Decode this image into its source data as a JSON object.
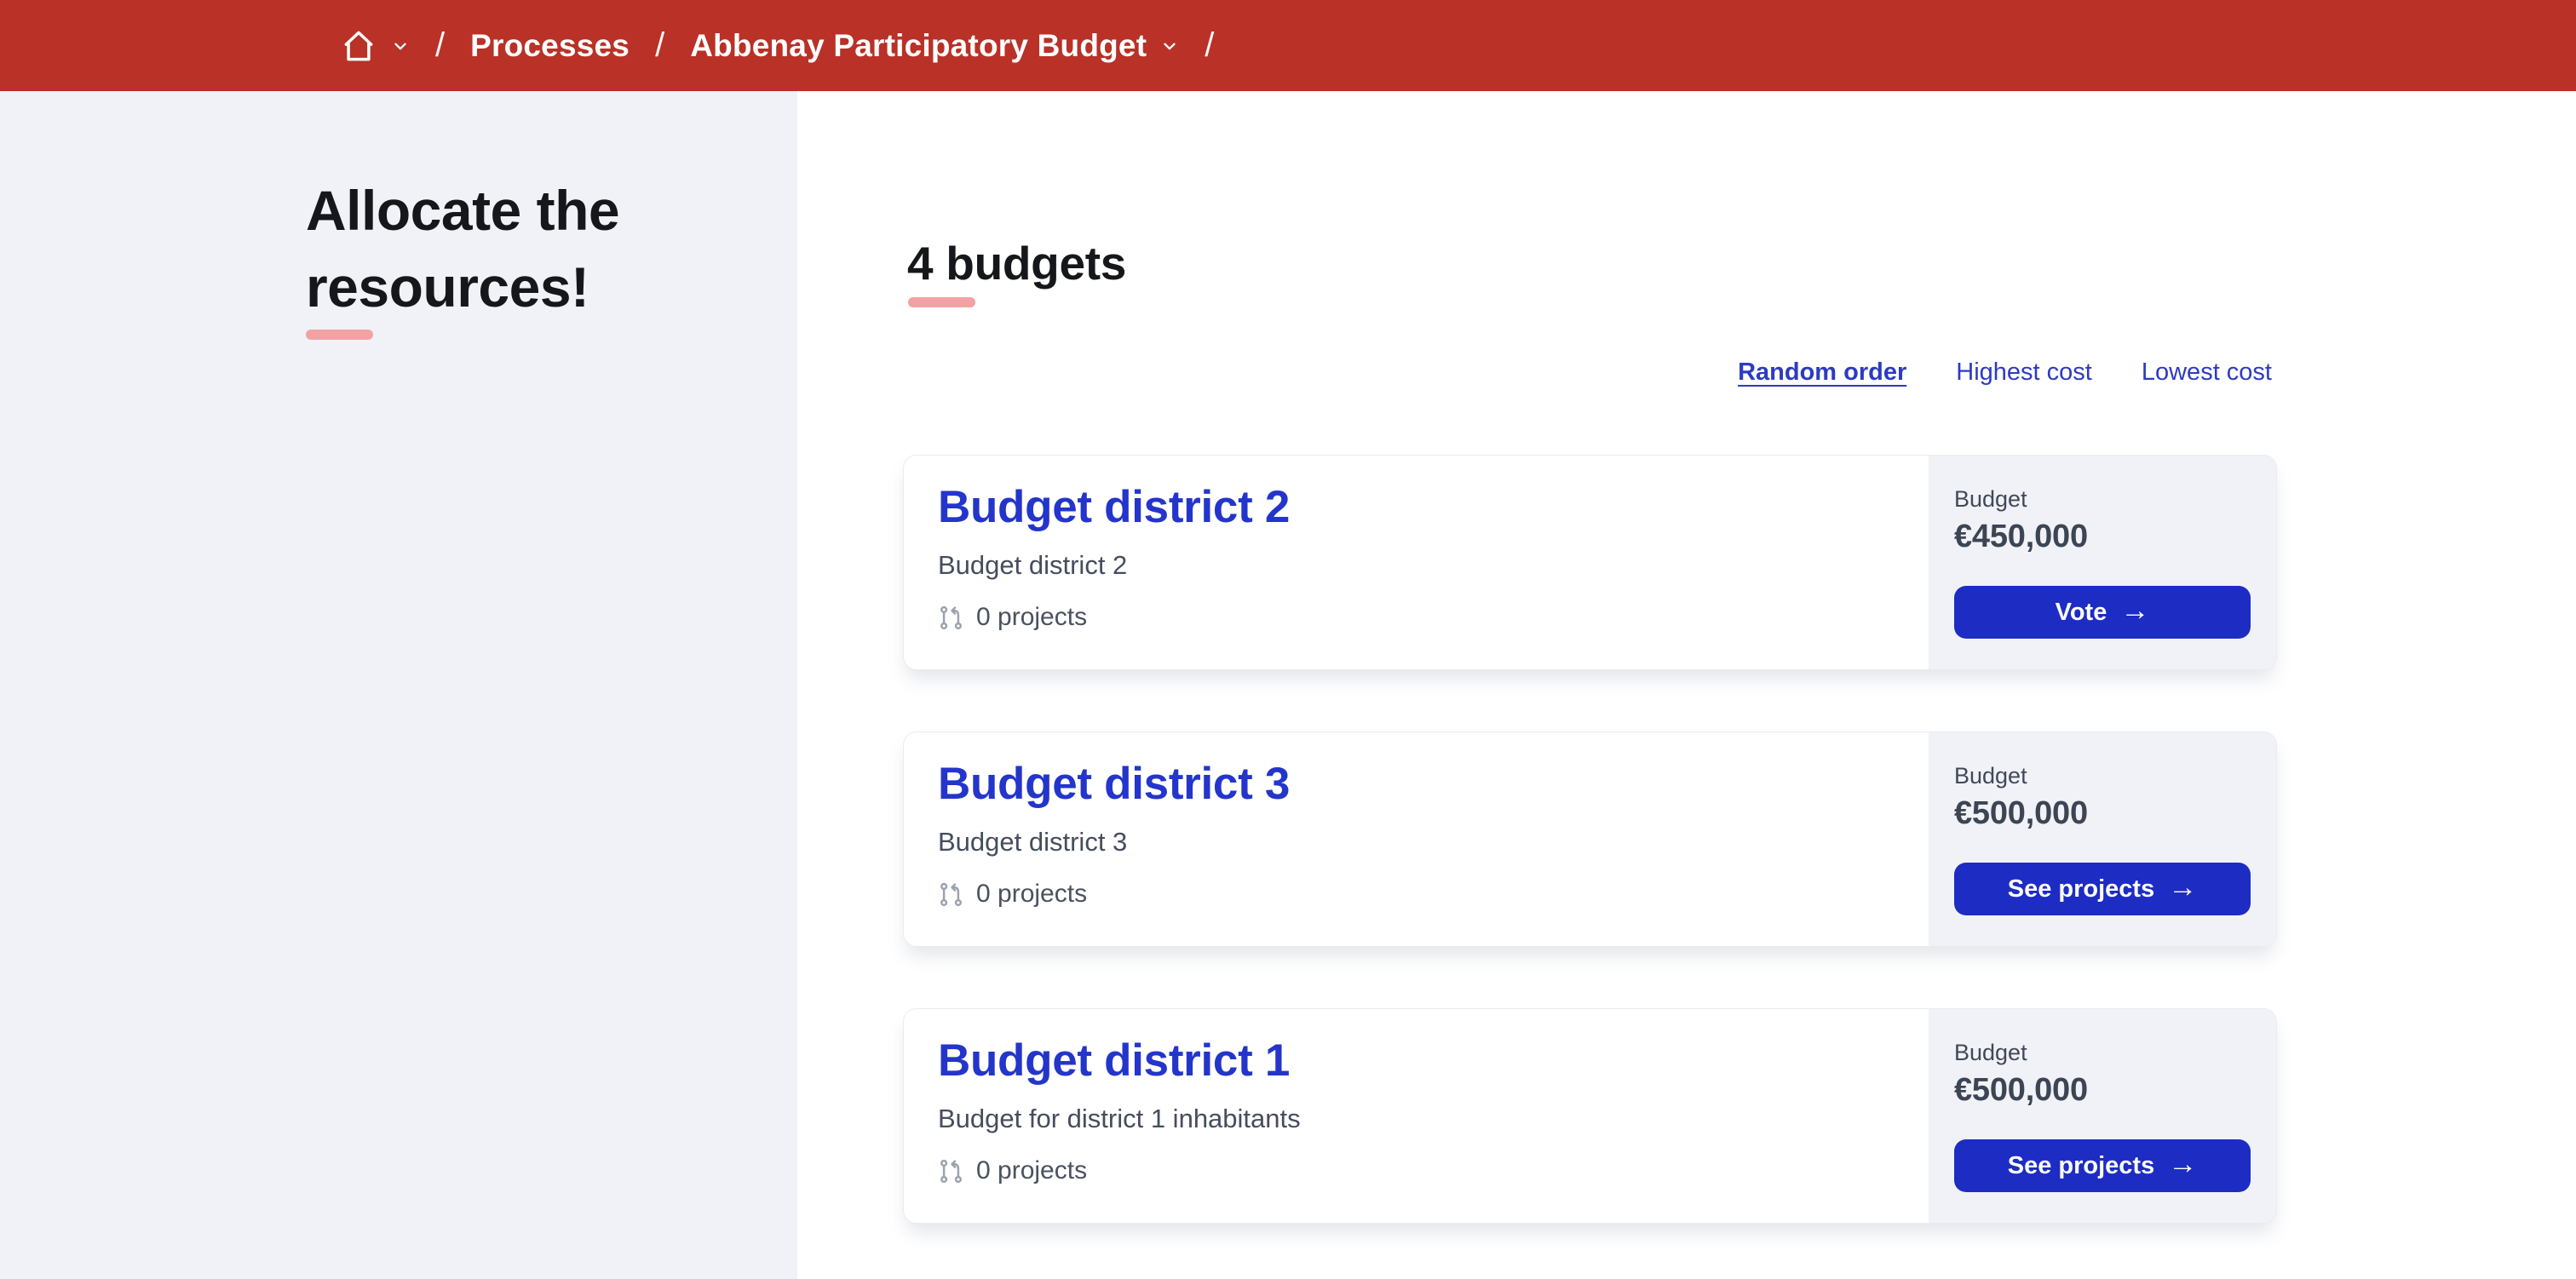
{
  "header": {
    "bg_color": "#B93127",
    "breadcrumb": {
      "separator": "/",
      "home_icon": "home-icon",
      "items": [
        {
          "label": "Processes",
          "has_dropdown": false
        },
        {
          "label": "Abbenay Participatory Budget",
          "has_dropdown": true
        }
      ]
    }
  },
  "sidebar": {
    "title": "Allocate the resources!",
    "bg_color": "#F1F2F7",
    "accent_color": "#F2A2A2"
  },
  "main": {
    "heading": "4 budgets",
    "sort_options": [
      {
        "label": "Random order",
        "active": true
      },
      {
        "label": "Highest cost",
        "active": false
      },
      {
        "label": "Lowest cost",
        "active": false
      }
    ],
    "cards": [
      {
        "title": "Budget district 2",
        "description": "Budget district 2",
        "projects_count": "0 projects",
        "budget_label": "Budget",
        "amount": "€450,000",
        "action_label": "Vote"
      },
      {
        "title": "Budget district 3",
        "description": "Budget district 3",
        "projects_count": "0 projects",
        "budget_label": "Budget",
        "amount": "€500,000",
        "action_label": "See projects"
      },
      {
        "title": "Budget district 1",
        "description": "Budget for district 1 inhabitants",
        "projects_count": "0 projects",
        "budget_label": "Budget",
        "amount": "€500,000",
        "action_label": "See projects"
      }
    ]
  },
  "icons": {
    "arrow_right": "→"
  },
  "colors": {
    "link_blue": "#2435CC",
    "button_blue": "#1D2CC3",
    "sort_blue": "#2C3BC2",
    "accent_salmon": "#F2A2A2",
    "panel_gray": "#F1F2F7",
    "text_dark": "#15171B",
    "text_slate": "#3C4554"
  }
}
